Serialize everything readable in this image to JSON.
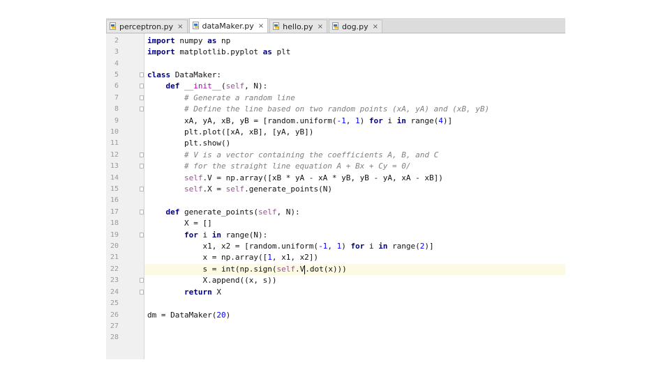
{
  "tabs": [
    {
      "label": "perceptron.py",
      "active": false
    },
    {
      "label": "dataMaker.py",
      "active": true
    },
    {
      "label": "hello.py",
      "active": false
    },
    {
      "label": "dog.py",
      "active": false
    }
  ],
  "close_glyph": "×",
  "current_line": 22,
  "lines": [
    {
      "num": "2"
    },
    {
      "num": "3"
    },
    {
      "num": "4"
    },
    {
      "num": "5"
    },
    {
      "num": "6"
    },
    {
      "num": "7"
    },
    {
      "num": "8"
    },
    {
      "num": "9"
    },
    {
      "num": "10"
    },
    {
      "num": "11"
    },
    {
      "num": "12"
    },
    {
      "num": "13"
    },
    {
      "num": "14"
    },
    {
      "num": "15"
    },
    {
      "num": "16"
    },
    {
      "num": "17"
    },
    {
      "num": "18"
    },
    {
      "num": "19"
    },
    {
      "num": "20"
    },
    {
      "num": "21"
    },
    {
      "num": "22"
    },
    {
      "num": "23"
    },
    {
      "num": "24"
    },
    {
      "num": "25"
    },
    {
      "num": "26"
    },
    {
      "num": "27"
    },
    {
      "num": "28"
    }
  ],
  "code": {
    "t_import": "import",
    "t_numpy": " numpy ",
    "t_as": "as",
    "t_np": " np",
    "t_matplotlib": " matplotlib.pyplot ",
    "t_plt": " plt",
    "t_class": "class",
    "t_datamaker_decl": " DataMaker:",
    "t_def": "def",
    "t_init": "__init__",
    "t_self": "self",
    "t_init_tail": ", N):",
    "t_cm1": "# Generate a random line",
    "t_cm2": "# Define the line based on two random points (xA, yA) and (xB, yB)",
    "t_l9a": "xA, yA, xB, yB = [random.uniform(",
    "t_n_neg1": "-1",
    "t_comma_sp": ", ",
    "t_n_1": "1",
    "t_close_sp": ") ",
    "t_for": "for",
    "t_i": " i ",
    "t_in": "in",
    "t_range4": " range(",
    "t_n_4": "4",
    "t_close_bracket": ")]",
    "t_l11": "plt.plot([xA, xB], [yA, yB])",
    "t_l12": "plt.show()",
    "t_cm3": "# V is a vector containing the coefficients A, B, and C",
    "t_cm4": "# for the straight line equation A + Bx + Cy = 0/",
    "t_dotV": ".V = np.array([xB * yA - xA * yB, yB - yA, xA - xB])",
    "t_dotX": ".X = ",
    "t_dot_gen": ".generate_points(N)",
    "t_genpoints": " generate_points(",
    "t_gen_tail": ", N):",
    "t_l19": "X = []",
    "t_range_n": " range(N):",
    "t_l21a": "x1, x2 = [random.uniform(",
    "t_range2": " range(",
    "t_n_2": "2",
    "t_l22a": "x = np.array([",
    "t_l22b": ", x1, x2])",
    "t_l23a": "s = int(np.sign(",
    "t_dotV2": ".V",
    "t_l23b": ".dot(x)))",
    "t_l24": "X.append((x, s))",
    "t_return": "return",
    "t_retX": " X",
    "t_l27a": "dm = DataMaker(",
    "t_n_20": "20",
    "t_close": ")"
  }
}
